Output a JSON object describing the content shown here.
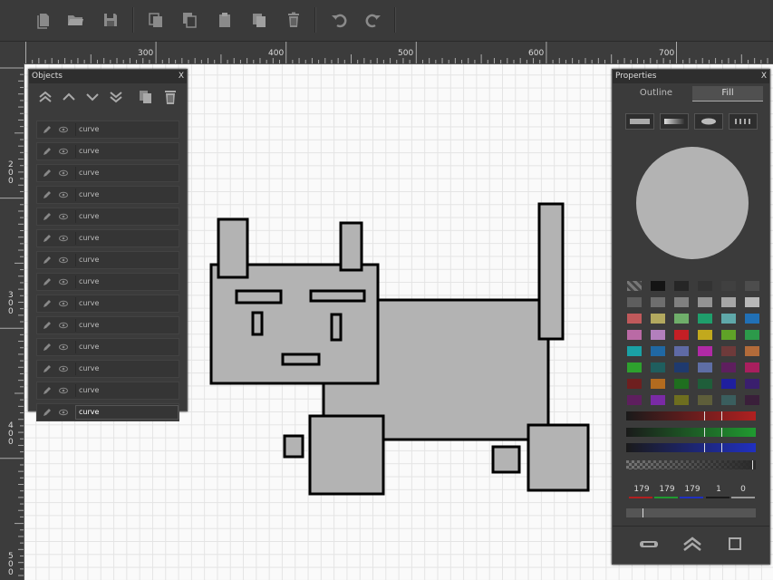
{
  "toolbar": {
    "buttons": [
      {
        "name": "new-document-icon"
      },
      {
        "name": "open-folder-icon"
      },
      {
        "name": "save-icon"
      },
      {
        "name": "cut-icon"
      },
      {
        "name": "copy-icon"
      },
      {
        "name": "paste-icon"
      },
      {
        "name": "duplicate-icon"
      },
      {
        "name": "trash-icon"
      },
      {
        "name": "undo-icon"
      },
      {
        "name": "redo-icon"
      }
    ]
  },
  "ruler": {
    "h_labels": [
      "300",
      "400",
      "500",
      "600",
      "700"
    ],
    "v_labels": [
      "200",
      "300",
      "400",
      "500"
    ]
  },
  "objects_panel": {
    "title": "Objects",
    "close": "X",
    "items": [
      "curve",
      "curve",
      "curve",
      "curve",
      "curve",
      "curve",
      "curve",
      "curve",
      "curve",
      "curve",
      "curve",
      "curve",
      "curve",
      "curve"
    ],
    "selected_index": 13
  },
  "properties_panel": {
    "title": "Properties",
    "close": "X",
    "tabs": [
      "Outline",
      "Fill"
    ],
    "active_tab": "Fill",
    "preview_color": "#b3b3b3",
    "rgba": {
      "r": "179",
      "g": "179",
      "b": "179",
      "a": "1",
      "extra": "0"
    }
  },
  "colors": {
    "shape_fill": "#b3b3b3",
    "shape_stroke": "#000000",
    "palette": [
      [
        "#3a3a3a",
        "#141414",
        "#262626",
        "#333333",
        "#404040",
        "#4d4d4d"
      ],
      [
        "#5e5e5e",
        "#6e6e6e",
        "#808080",
        "#939393",
        "#a6a6a6",
        "#b8b8b8"
      ],
      [
        "#c0595b",
        "#b3a95f",
        "#6fae6a",
        "#1f9e6b",
        "#5fa8a9",
        "#2170b5"
      ],
      [
        "#ba6aa5",
        "#b37fbd",
        "#c41f25",
        "#c2a91d",
        "#5fa227",
        "#2c9a4a"
      ],
      [
        "#1aa1a5",
        "#2068a3",
        "#5f6aa5",
        "#b12aa5",
        "#6e3a3a",
        "#b26b3a"
      ],
      [
        "#2ea12e",
        "#1f5e5e",
        "#1f3a6e",
        "#5e6ea5",
        "#5e1f5e",
        "#a81f5e"
      ],
      [
        "#6e1f1f",
        "#b26b1f",
        "#1f6e1f",
        "#1f5e3a",
        "#1f1f9e",
        "#3a1f6e"
      ],
      [
        "#5e1f5e",
        "#7a2aa5",
        "#6e6e1f",
        "#5e5e3a",
        "#3a5e5e",
        "#3a1f3a"
      ]
    ]
  }
}
